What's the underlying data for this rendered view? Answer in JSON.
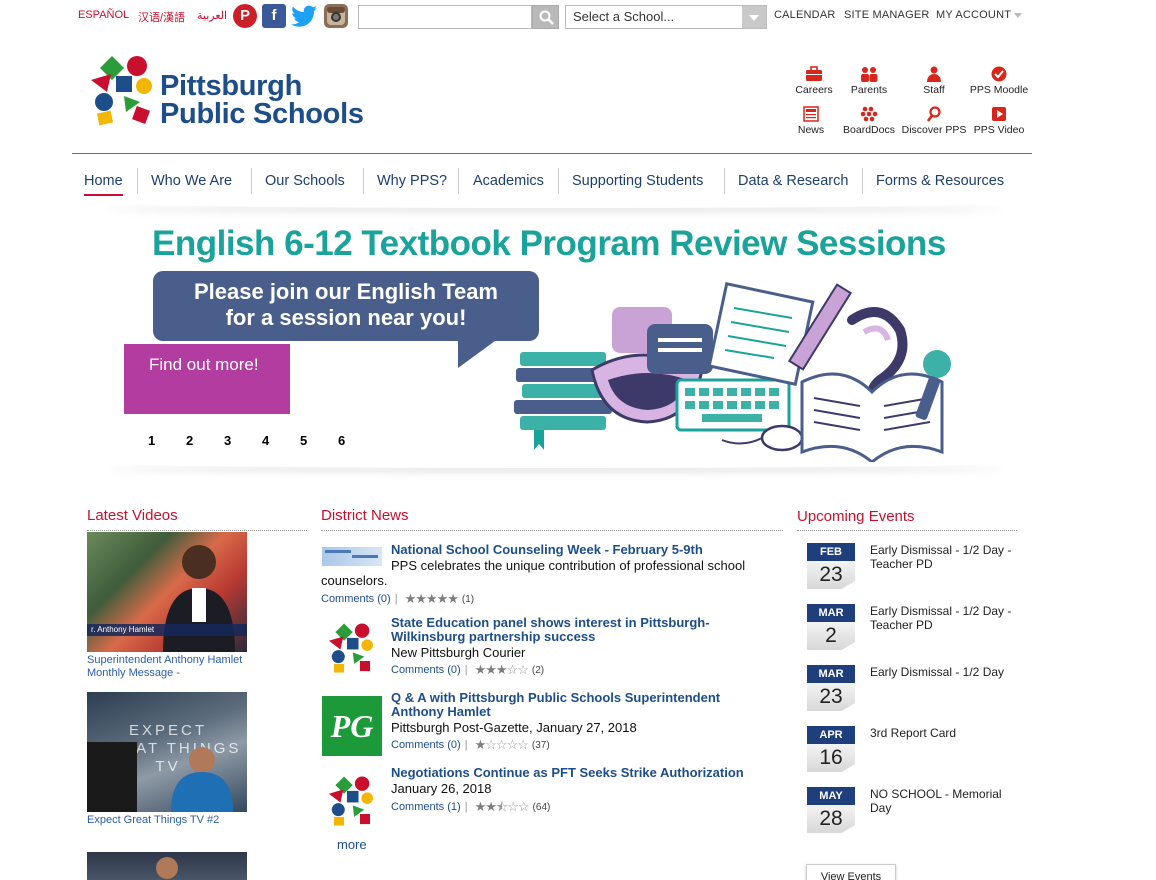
{
  "languages": [
    "ESPAÑOL",
    "汉语/漢語",
    "العربية"
  ],
  "search": {
    "placeholder": ""
  },
  "school_select": {
    "selected": "Select a School..."
  },
  "toplinks": [
    "CALENDAR",
    "SITE MANAGER",
    "MY ACCOUNT"
  ],
  "logo": {
    "line1": "Pittsburgh",
    "line2": "Public Schools"
  },
  "quicklinks": [
    {
      "label": "Careers",
      "icon": "briefcase-icon"
    },
    {
      "label": "Parents",
      "icon": "parents-icon"
    },
    {
      "label": "Staff",
      "icon": "staff-icon"
    },
    {
      "label": "PPS Moodle",
      "icon": "checkmark-icon"
    },
    {
      "label": "News",
      "icon": "newspaper-icon"
    },
    {
      "label": "BoardDocs",
      "icon": "boarddocs-icon"
    },
    {
      "label": "Discover PPS",
      "icon": "magnifier-icon"
    },
    {
      "label": "PPS Video",
      "icon": "play-icon"
    }
  ],
  "nav": [
    "Home",
    "Who We Are",
    "Our Schools",
    "Why PPS?",
    "Academics",
    "Supporting Students",
    "Data & Research",
    "Forms & Resources"
  ],
  "banner": {
    "title": "English 6-12 Textbook Program Review Sessions",
    "bubble_line1": "Please join our English Team",
    "bubble_line2": "for a session near you!",
    "cta": "Find out more!",
    "slides": [
      "1",
      "2",
      "3",
      "4",
      "5",
      "6"
    ]
  },
  "videos": {
    "title": "Latest Videos",
    "items": [
      {
        "caption": "Superintendent Anthony Hamlet Monthly Message -",
        "overlay": "r. Anthony Hamlet"
      },
      {
        "caption": "Expect Great Things TV #2",
        "overlay": "EXPECT GREAT THINGS TV"
      }
    ]
  },
  "news": {
    "title": "District News",
    "items": [
      {
        "title": "National School Counseling Week - February 5-9th",
        "sub": "PPS celebrates the unique contribution of professional school counselors.",
        "comments": "Comments (0)",
        "rating": 5,
        "count": "(1)"
      },
      {
        "title": "State Education panel shows interest in Pittsburgh-Wilkinsburg partnership success",
        "sub": "New Pittsburgh Courier",
        "comments": "Comments (0)",
        "rating": 3,
        "count": "(2)"
      },
      {
        "title": "Q & A with Pittsburgh Public Schools Superintendent Anthony Hamlet",
        "sub": "Pittsburgh Post-Gazette, January 27, 2018",
        "comments": "Comments (0)",
        "rating": 1,
        "count": "(37)"
      },
      {
        "title": "Negotiations Continue as PFT Seeks Strike Authorization",
        "sub": "January 26, 2018",
        "comments": "Comments (1)",
        "rating": 2.5,
        "count": "(64)"
      }
    ],
    "more": "more",
    "pg_logo": "PG"
  },
  "events": {
    "title": "Upcoming Events",
    "items": [
      {
        "month": "FEB",
        "day": "23",
        "text": "Early Dismissal - 1/2 Day - Teacher PD"
      },
      {
        "month": "MAR",
        "day": "2",
        "text": "Early Dismissal - 1/2 Day - Teacher PD"
      },
      {
        "month": "MAR",
        "day": "23",
        "text": "Early Dismissal - 1/2 Day"
      },
      {
        "month": "APR",
        "day": "16",
        "text": "3rd Report Card"
      },
      {
        "month": "MAY",
        "day": "28",
        "text": "NO SCHOOL - Memorial Day"
      }
    ],
    "view_all": "View Events"
  },
  "colors": {
    "brand_blue": "#1d4e89",
    "brand_red": "#c8102e",
    "teal": "#1aa39a",
    "magenta": "#b23ca0",
    "bubble": "#4a5e8c"
  }
}
